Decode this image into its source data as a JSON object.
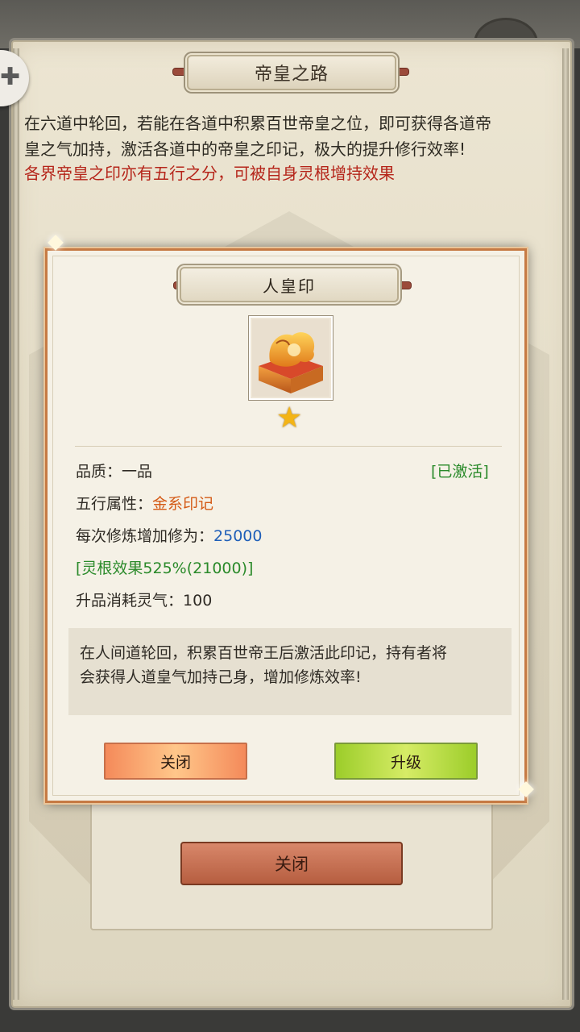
{
  "background": {
    "title": "帝皇之路",
    "description_lines": [
      "在六道中轮回，若能在各道中积累百世帝皇之位，即可获得各道帝",
      "皇之气加持，激活各道中的帝皇之印记，极大的提升修行效率!"
    ],
    "highlight_line": "各界帝皇之印亦有五行之分，可被自身灵根增持效果",
    "close_button": "关闭"
  },
  "modal": {
    "title": "人皇印",
    "item_icon": "imperial-seal-icon",
    "stars": "★",
    "quality_label": "品质：",
    "quality_value": "一品",
    "status": "[已激活]",
    "element_label": "五行属性：",
    "element_value": "金系印记",
    "cultivation_label": "每次修炼增加修为：",
    "cultivation_value": "25000",
    "root_effect": "[灵根效果525%(21000)]",
    "upgrade_cost_label": "升品消耗灵气：",
    "upgrade_cost_value": "100",
    "lore_lines": [
      "在人间道轮回，积累百世帝王后激活此印记，持有者将",
      "会获得人道皇气加持己身，增加修炼效率!"
    ],
    "close_button": "关闭",
    "upgrade_button": "升级"
  },
  "colors": {
    "highlight_red": "#b5251a",
    "status_green": "#2a8a2a",
    "element_orange": "#d45a16",
    "value_blue": "#1f5fb8"
  }
}
